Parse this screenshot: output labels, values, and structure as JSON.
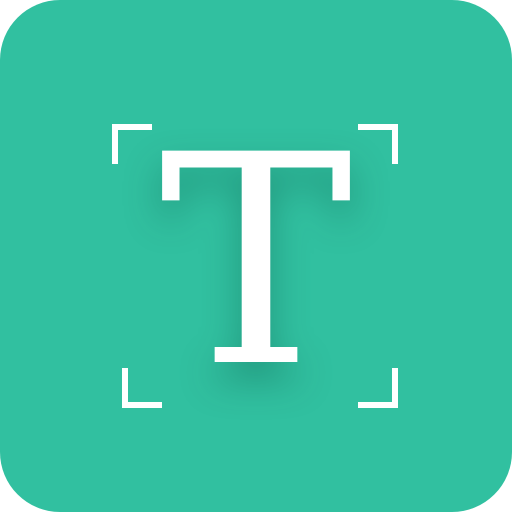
{
  "icon": {
    "glyph": "T",
    "background_color": "#31c0a0",
    "foreground_color": "#ffffff",
    "frame_icon": "scan-corners-icon"
  }
}
